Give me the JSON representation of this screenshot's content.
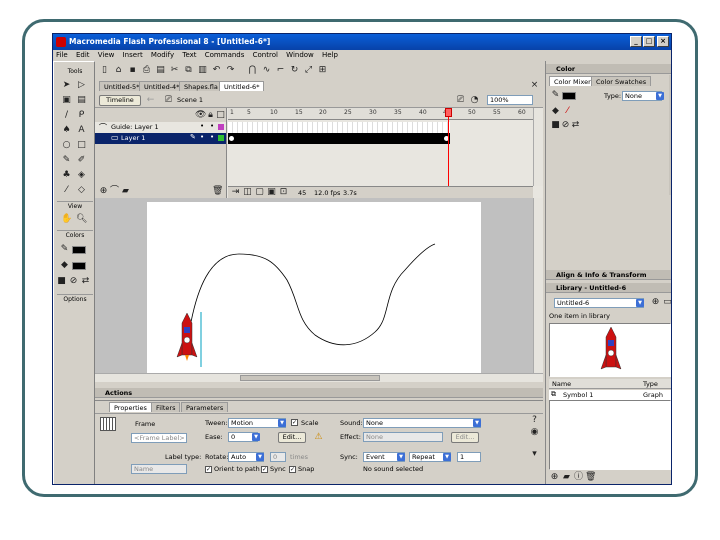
{
  "window": {
    "title": "Macromedia Flash Professional 8 - [Untitled-6*]"
  },
  "menu": [
    "File",
    "Edit",
    "View",
    "Insert",
    "Modify",
    "Text",
    "Commands",
    "Control",
    "Window",
    "Help"
  ],
  "tools": {
    "header": "Tools",
    "view_label": "View",
    "colors_label": "Colors",
    "options_label": "Options"
  },
  "doc_tabs": [
    "Untitled-5*",
    "Untitled-4*",
    "Shapes.fla",
    "Untitled-6*"
  ],
  "edit_bar": {
    "scene_label": "Timeline",
    "scene_name": "Scene 1",
    "zoom": "100%"
  },
  "timeline": {
    "ruler": [
      "1",
      "5",
      "10",
      "15",
      "20",
      "25",
      "30",
      "35",
      "40",
      "45",
      "50",
      "55",
      "60",
      "65"
    ],
    "layers": [
      {
        "name": "Guide: Layer 1"
      },
      {
        "name": "Layer 1"
      }
    ],
    "status": [
      "45",
      "12.0 fps",
      "3.7s"
    ]
  },
  "actions_label": "Actions",
  "properties": {
    "tabs": [
      "Properties",
      "Filters",
      "Parameters"
    ],
    "frame_label": "Frame",
    "frame_placeholder": "<Frame Label>",
    "tween_label": "Tween:",
    "tween_value": "Motion",
    "scale_label": "Scale",
    "ease_label": "Ease:",
    "ease_value": "0",
    "edit_button": "Edit...",
    "rotate_label": "Rotate:",
    "rotate_value": "Auto",
    "times_value": "0",
    "times_label": "times",
    "orient_label": "Orient to path",
    "sync_label": "Sync",
    "snap_label": "Snap",
    "label_type_label": "Label type:",
    "label_type_value": "Name",
    "sound_label": "Sound:",
    "sound_value": "None",
    "effect_label": "Effect:",
    "effect_value": "None",
    "effect_edit": "Edit...",
    "sync2_label": "Sync:",
    "sync2_value": "Event",
    "repeat_value": "Repeat",
    "repeat_count": "1",
    "no_sound": "No sound selected"
  },
  "color_panel": {
    "title": "Color",
    "tabs": [
      "Color Mixer",
      "Color Swatches"
    ],
    "type_label": "Type:",
    "type_value": "None"
  },
  "align_panel": {
    "title": "Align & Info & Transform"
  },
  "library": {
    "title": "Library - Untitled-6",
    "doc": "Untitled-6",
    "count": "One item in library",
    "col_name": "Name",
    "col_type": "Type",
    "items": [
      {
        "name": "Symbol 1",
        "type": "Graph"
      }
    ]
  },
  "colors": {
    "titlebar": "#0a5fd8",
    "stage": "#ffffff",
    "workspace": "#c0c0c0",
    "playhead": "#ff0000",
    "rocket": "#cc1111"
  }
}
